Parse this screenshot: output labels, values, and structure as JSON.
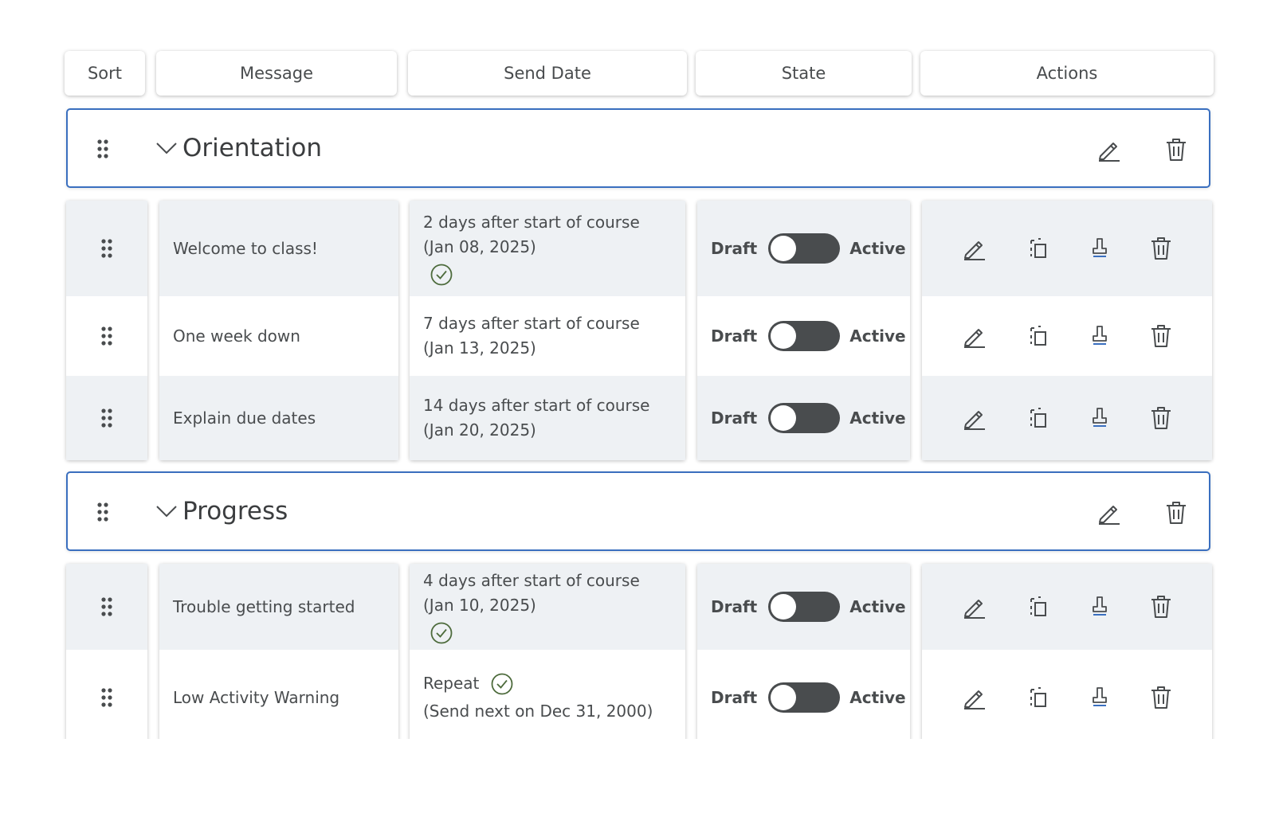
{
  "headers": {
    "sort": "Sort",
    "message": "Message",
    "send_date": "Send Date",
    "state": "State",
    "actions": "Actions"
  },
  "groups": [
    {
      "title": "Orientation",
      "rows": [
        {
          "message": "Welcome to class!",
          "date_line1": "2 days after start of course",
          "date_line2": "(Jan 08, 2025)",
          "has_check": true,
          "state_off": "Draft",
          "state_on": "Active",
          "toggle_on": false
        },
        {
          "message": "One week down",
          "date_line1": "7 days after start of course",
          "date_line2": "(Jan 13, 2025)",
          "has_check": false,
          "state_off": "Draft",
          "state_on": "Active",
          "toggle_on": false
        },
        {
          "message": "Explain due dates",
          "date_line1": "14 days after start of course",
          "date_line2": "(Jan 20, 2025)",
          "has_check": false,
          "state_off": "Draft",
          "state_on": "Active",
          "toggle_on": false
        }
      ]
    },
    {
      "title": "Progress",
      "rows": [
        {
          "message": "Trouble getting started",
          "date_line1": "4 days after start of course",
          "date_line2": "(Jan 10, 2025)",
          "has_check": true,
          "state_off": "Draft",
          "state_on": "Active",
          "toggle_on": false
        },
        {
          "message": "Low Activity Warning",
          "date_line1": "Repeat",
          "date_line2": "(Send next on Dec 31, 2000)",
          "has_check": true,
          "state_off": "Draft",
          "state_on": "Active",
          "toggle_on": false
        }
      ]
    }
  ],
  "colors": {
    "group_border": "#3a6fbf",
    "toggle_track": "#494c4e",
    "check": "#4d6b3c",
    "odd_row": "#eef1f4"
  },
  "icons": [
    "drag-handle-icon",
    "chevron-down-icon",
    "pencil-icon",
    "copy-icon",
    "stamp-icon",
    "trash-icon",
    "check-circle-icon"
  ]
}
